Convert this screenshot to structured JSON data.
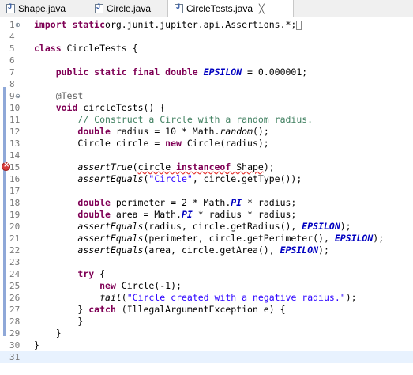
{
  "tabs": [
    {
      "label": "Shape.java",
      "active": false,
      "icon": "java-file-icon"
    },
    {
      "label": "Circle.java",
      "active": false,
      "icon": "java-file-icon"
    },
    {
      "label": "CircleTests.java",
      "active": true,
      "icon": "java-file-icon",
      "close": "╳"
    }
  ],
  "colors": {
    "keyword": "#7f0055",
    "comment": "#3f7f5f",
    "string": "#2a00ff",
    "annotation": "#646464",
    "constant": "#0000c0",
    "coverage": "#8fa8d8",
    "current_line": "#e8f2fe",
    "error_marker": "#d83b3b"
  },
  "gutter_markers": {
    "fold_expand": "⊕",
    "fold_collapse": "⊖",
    "error_icon": "error-marker-icon"
  },
  "lines": [
    {
      "num": "1",
      "fold": "⊕",
      "seg": [
        [
          "kw",
          "import static"
        ],
        [
          "",
          "org.junit.jupiter.api.Assertions.*;"
        ],
        [
          "cursor",
          ""
        ]
      ]
    },
    {
      "num": "4",
      "seg": []
    },
    {
      "num": "5",
      "seg": [
        [
          "kw",
          "class"
        ],
        [
          "",
          " CircleTests {"
        ]
      ]
    },
    {
      "num": "6",
      "seg": []
    },
    {
      "num": "7",
      "seg": [
        [
          "",
          "    "
        ],
        [
          "kw",
          "public static final double"
        ],
        [
          "",
          " "
        ],
        [
          "cst",
          "EPSILON"
        ],
        [
          "",
          " = 0.000001;"
        ]
      ]
    },
    {
      "num": "8",
      "seg": []
    },
    {
      "num": "9",
      "fold": "⊖",
      "seg": [
        [
          "",
          "    "
        ],
        [
          "ann",
          "@Test"
        ]
      ]
    },
    {
      "num": "10",
      "seg": [
        [
          "",
          "    "
        ],
        [
          "kw",
          "void"
        ],
        [
          "",
          " circleTests() {"
        ]
      ]
    },
    {
      "num": "11",
      "seg": [
        [
          "",
          "        "
        ],
        [
          "cmt",
          "// Construct a Circle with a random radius."
        ]
      ]
    },
    {
      "num": "12",
      "seg": [
        [
          "",
          "        "
        ],
        [
          "kw",
          "double"
        ],
        [
          "",
          " radius = 10 * Math."
        ],
        [
          "it",
          "random"
        ],
        [
          "",
          "();"
        ]
      ]
    },
    {
      "num": "13",
      "seg": [
        [
          "",
          "        Circle circle = "
        ],
        [
          "kw",
          "new"
        ],
        [
          "",
          " Circle(radius);"
        ]
      ]
    },
    {
      "num": "14",
      "seg": []
    },
    {
      "num": "15",
      "seg": [
        [
          "",
          "        "
        ],
        [
          "it",
          "assertTrue"
        ],
        [
          "",
          "("
        ],
        [
          "err",
          "circle "
        ],
        [
          "kw err",
          "instanceof"
        ],
        [
          "err",
          " Shape"
        ],
        [
          "",
          ");"
        ]
      ]
    },
    {
      "num": "16",
      "seg": [
        [
          "",
          "        "
        ],
        [
          "it",
          "assertEquals"
        ],
        [
          "",
          "("
        ],
        [
          "str",
          "\"Circle\""
        ],
        [
          "",
          ", circle.getType());"
        ]
      ]
    },
    {
      "num": "17",
      "seg": []
    },
    {
      "num": "18",
      "seg": [
        [
          "",
          "        "
        ],
        [
          "kw",
          "double"
        ],
        [
          "",
          " perimeter = 2 * Math."
        ],
        [
          "cst",
          "PI"
        ],
        [
          "",
          " * radius;"
        ]
      ]
    },
    {
      "num": "19",
      "seg": [
        [
          "",
          "        "
        ],
        [
          "kw",
          "double"
        ],
        [
          "",
          " area = Math."
        ],
        [
          "cst",
          "PI"
        ],
        [
          "",
          " * radius * radius;"
        ]
      ]
    },
    {
      "num": "20",
      "seg": [
        [
          "",
          "        "
        ],
        [
          "it",
          "assertEquals"
        ],
        [
          "",
          "(radius, circle.getRadius(), "
        ],
        [
          "cst",
          "EPSILON"
        ],
        [
          "",
          ");"
        ]
      ]
    },
    {
      "num": "21",
      "seg": [
        [
          "",
          "        "
        ],
        [
          "it",
          "assertEquals"
        ],
        [
          "",
          "(perimeter, circle.getPerimeter(), "
        ],
        [
          "cst",
          "EPSILON"
        ],
        [
          "",
          ");"
        ]
      ]
    },
    {
      "num": "22",
      "seg": [
        [
          "",
          "        "
        ],
        [
          "it",
          "assertEquals"
        ],
        [
          "",
          "(area, circle.getArea(), "
        ],
        [
          "cst",
          "EPSILON"
        ],
        [
          "",
          ");"
        ]
      ]
    },
    {
      "num": "23",
      "seg": []
    },
    {
      "num": "24",
      "seg": [
        [
          "",
          "        "
        ],
        [
          "kw",
          "try"
        ],
        [
          "",
          " {"
        ]
      ]
    },
    {
      "num": "25",
      "seg": [
        [
          "",
          "            "
        ],
        [
          "kw",
          "new"
        ],
        [
          "",
          " Circle(-1);"
        ]
      ]
    },
    {
      "num": "26",
      "seg": [
        [
          "",
          "            "
        ],
        [
          "it",
          "fail"
        ],
        [
          "",
          "("
        ],
        [
          "str",
          "\"Circle created with a negative radius.\""
        ],
        [
          "",
          ");"
        ]
      ]
    },
    {
      "num": "27",
      "seg": [
        [
          "",
          "        } "
        ],
        [
          "kw",
          "catch"
        ],
        [
          "",
          " (IllegalArgumentException e) {"
        ]
      ]
    },
    {
      "num": "28",
      "seg": [
        [
          "",
          "        }"
        ]
      ]
    },
    {
      "num": "29",
      "seg": [
        [
          "",
          "    }"
        ]
      ]
    },
    {
      "num": "30",
      "seg": [
        [
          "",
          "}"
        ]
      ]
    },
    {
      "num": "31",
      "current": true,
      "seg": []
    }
  ]
}
